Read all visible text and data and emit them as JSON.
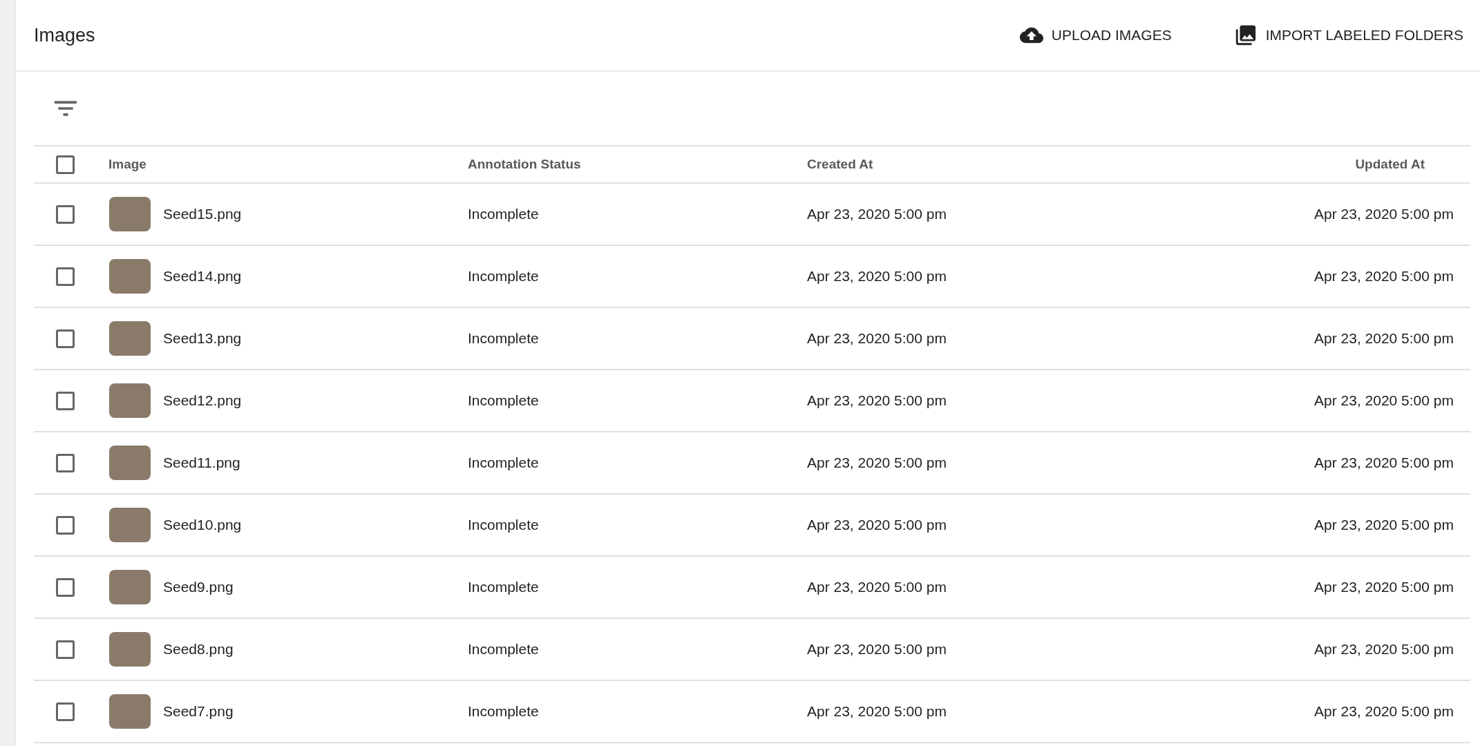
{
  "header": {
    "title": "Images",
    "buttons": [
      {
        "kind": "upload",
        "label": "UPLOAD IMAGES"
      },
      {
        "kind": "import",
        "label": "IMPORT LABELED FOLDERS"
      }
    ]
  },
  "table": {
    "select_all": {
      "checked": false
    },
    "columns": [
      "Image",
      "Annotation Status",
      "Created At",
      "Updated At"
    ],
    "rows": [
      {
        "checked": false,
        "name": "Seed15.png",
        "status": "Incomplete",
        "created": "Apr 23, 2020 5:00 pm",
        "updated": "Apr 23, 2020 5:00 pm"
      },
      {
        "checked": false,
        "name": "Seed14.png",
        "status": "Incomplete",
        "created": "Apr 23, 2020 5:00 pm",
        "updated": "Apr 23, 2020 5:00 pm"
      },
      {
        "checked": false,
        "name": "Seed13.png",
        "status": "Incomplete",
        "created": "Apr 23, 2020 5:00 pm",
        "updated": "Apr 23, 2020 5:00 pm"
      },
      {
        "checked": false,
        "name": "Seed12.png",
        "status": "Incomplete",
        "created": "Apr 23, 2020 5:00 pm",
        "updated": "Apr 23, 2020 5:00 pm"
      },
      {
        "checked": false,
        "name": "Seed11.png",
        "status": "Incomplete",
        "created": "Apr 23, 2020 5:00 pm",
        "updated": "Apr 23, 2020 5:00 pm"
      },
      {
        "checked": false,
        "name": "Seed10.png",
        "status": "Incomplete",
        "created": "Apr 23, 2020 5:00 pm",
        "updated": "Apr 23, 2020 5:00 pm"
      },
      {
        "checked": false,
        "name": "Seed9.png",
        "status": "Incomplete",
        "created": "Apr 23, 2020 5:00 pm",
        "updated": "Apr 23, 2020 5:00 pm"
      },
      {
        "checked": false,
        "name": "Seed8.png",
        "status": "Incomplete",
        "created": "Apr 23, 2020 5:00 pm",
        "updated": "Apr 23, 2020 5:00 pm"
      },
      {
        "checked": false,
        "name": "Seed7.png",
        "status": "Incomplete",
        "created": "Apr 23, 2020 5:00 pm",
        "updated": "Apr 23, 2020 5:00 pm"
      }
    ]
  }
}
